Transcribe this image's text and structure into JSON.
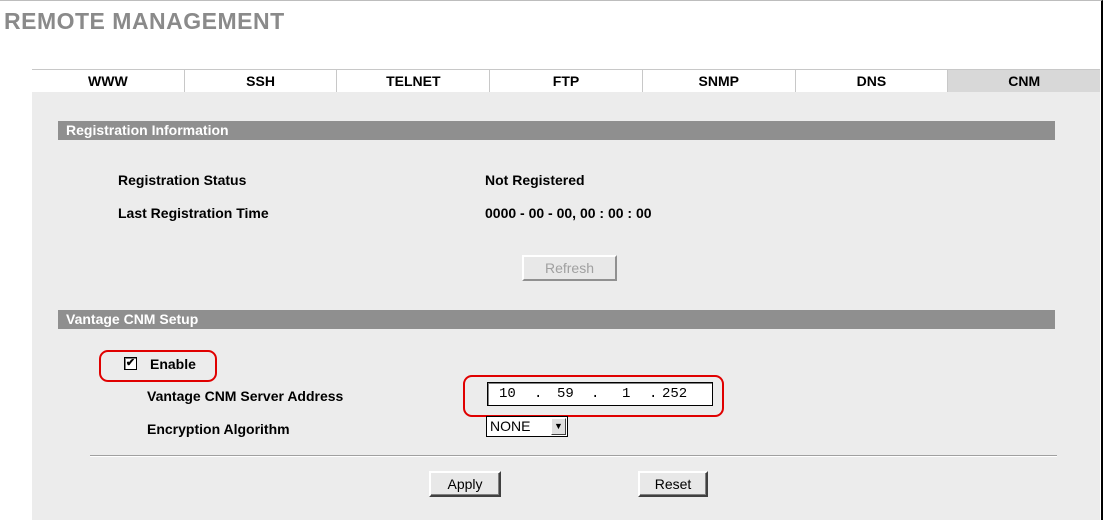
{
  "page_title": "REMOTE MANAGEMENT",
  "tabs": [
    {
      "label": "WWW"
    },
    {
      "label": "SSH"
    },
    {
      "label": "TELNET"
    },
    {
      "label": "FTP"
    },
    {
      "label": "SNMP"
    },
    {
      "label": "DNS"
    },
    {
      "label": "CNM",
      "active": true
    }
  ],
  "registration": {
    "section_title": "Registration Information",
    "status_label": "Registration Status",
    "status_value": "Not Registered",
    "time_label": "Last Registration Time",
    "time_value": "0000 - 00 - 00, 00 : 00 : 00",
    "refresh_label": "Refresh"
  },
  "cnm_setup": {
    "section_title": "Vantage CNM Setup",
    "enable_label": "Enable",
    "enable_checked": true,
    "server_label": "Vantage CNM Server Address",
    "ip_octets": [
      "10",
      "59",
      "1",
      "252"
    ],
    "ip_separator": ".",
    "encryption_label": "Encryption Algorithm",
    "encryption_value": "NONE"
  },
  "actions": {
    "apply_label": "Apply",
    "reset_label": "Reset"
  },
  "colors": {
    "section_bar": "#8f8f8f",
    "panel": "#ececec",
    "highlight": "#e00000",
    "title": "#8a8a8a"
  }
}
